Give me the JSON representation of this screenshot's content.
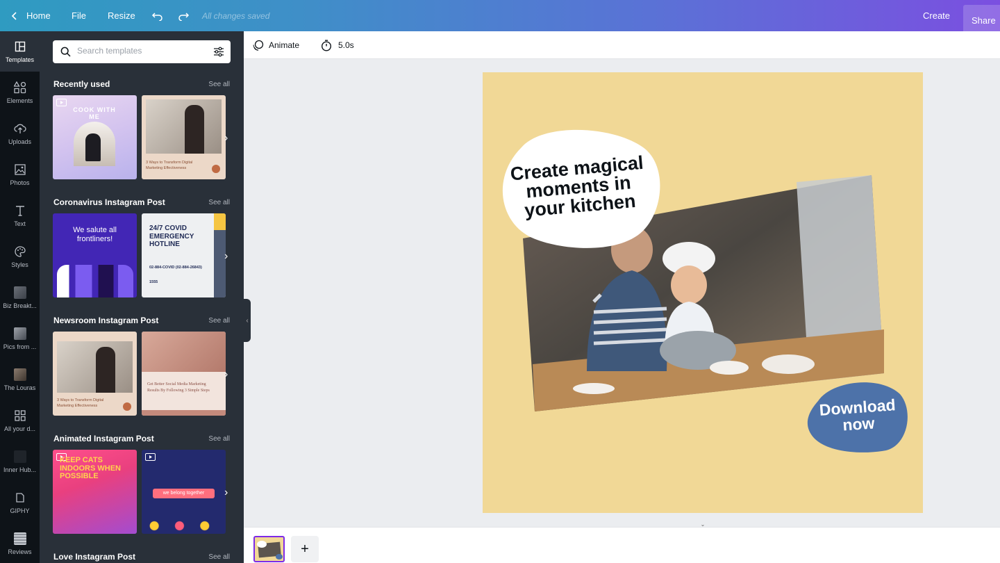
{
  "topbar": {
    "home_label": "Home",
    "file_label": "File",
    "resize_label": "Resize",
    "saved_status": "All changes saved",
    "create_label": "Create",
    "share_label": "Share"
  },
  "rail": {
    "items": [
      {
        "label": "Templates",
        "icon": "templates-icon"
      },
      {
        "label": "Elements",
        "icon": "elements-icon"
      },
      {
        "label": "Uploads",
        "icon": "upload-cloud-icon"
      },
      {
        "label": "Photos",
        "icon": "photos-icon"
      },
      {
        "label": "Text",
        "icon": "text-icon"
      },
      {
        "label": "Styles",
        "icon": "palette-icon"
      },
      {
        "label": "Biz Breakt...",
        "icon": "folder-thumb-icon"
      },
      {
        "label": "Pics from ...",
        "icon": "folder-thumb-icon"
      },
      {
        "label": "The Louras",
        "icon": "folder-thumb-icon"
      },
      {
        "label": "All your d...",
        "icon": "grid-icon"
      },
      {
        "label": "Inner Hub...",
        "icon": "folder-thumb-icon"
      },
      {
        "label": "GIPHY",
        "icon": "giphy-icon"
      },
      {
        "label": "Reviews",
        "icon": "reviews-icon"
      }
    ]
  },
  "panel": {
    "search_placeholder": "Search templates",
    "see_all": "See all",
    "sections": [
      {
        "title": "Recently used"
      },
      {
        "title": "Coronavirus Instagram Post"
      },
      {
        "title": "Newsroom Instagram Post"
      },
      {
        "title": "Animated Instagram Post"
      },
      {
        "title": "Love Instagram Post"
      }
    ],
    "thumbs": {
      "cook": "COOK WITH ME",
      "marketing": "3 Ways to Transform Digital Marketing Effectiveness",
      "salute": "We salute all frontliners!",
      "covid": "24/7 COVID EMERGENCY HOTLINE",
      "covid_number": "02-884-COVID (02-884-26843)",
      "covid_alt": "1555",
      "social": "Get Better Social Media Marketing Results By Following 3 Simple Steps",
      "cats": "KEEP CATS INDOORS WHEN POSSIBLE",
      "together": "we belong together"
    }
  },
  "toolbar": {
    "animate_label": "Animate",
    "duration_label": "5.0s"
  },
  "canvas": {
    "headline_1": "Create magical",
    "headline_2": "moments in",
    "headline_3": "your kitchen",
    "cta_1": "Download",
    "cta_2": "now"
  },
  "colors": {
    "canvas_bg": "#f1d896",
    "cta_blob": "#4d72a9",
    "brand_purple": "#7d2ae8",
    "panel_bg": "#293039"
  }
}
